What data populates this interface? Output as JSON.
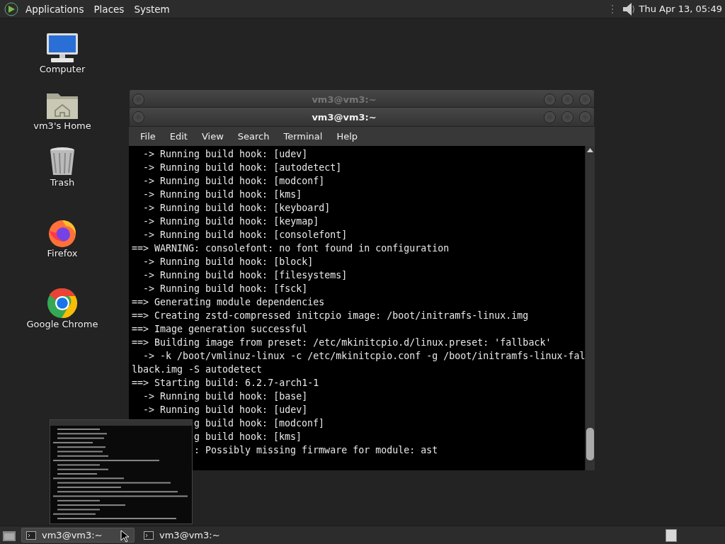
{
  "top_panel": {
    "menus": [
      "Applications",
      "Places",
      "System"
    ],
    "clock": "Thu Apr 13, 05:49"
  },
  "desktop_icons": [
    {
      "kind": "computer",
      "label": "Computer"
    },
    {
      "kind": "home",
      "label": "vm3's Home"
    },
    {
      "kind": "trash",
      "label": "Trash"
    },
    {
      "kind": "firefox",
      "label": "Firefox"
    },
    {
      "kind": "chrome",
      "label": "Google Chrome"
    }
  ],
  "windows": [
    {
      "title": "vm3@vm3:~",
      "active": false
    },
    {
      "title": "vm3@vm3:~",
      "active": true,
      "menu": [
        "File",
        "Edit",
        "View",
        "Search",
        "Terminal",
        "Help"
      ],
      "lines": [
        "  -> Running build hook: [udev]",
        "  -> Running build hook: [autodetect]",
        "  -> Running build hook: [modconf]",
        "  -> Running build hook: [kms]",
        "  -> Running build hook: [keyboard]",
        "  -> Running build hook: [keymap]",
        "  -> Running build hook: [consolefont]",
        "==> WARNING: consolefont: no font found in configuration",
        "  -> Running build hook: [block]",
        "  -> Running build hook: [filesystems]",
        "  -> Running build hook: [fsck]",
        "==> Generating module dependencies",
        "==> Creating zstd-compressed initcpio image: /boot/initramfs-linux.img",
        "==> Image generation successful",
        "==> Building image from preset: /etc/mkinitcpio.d/linux.preset: 'fallback'",
        "  -> -k /boot/vmlinuz-linux -c /etc/mkinitcpio.conf -g /boot/initramfs-linux-fal",
        "lback.img -S autodetect",
        "==> Starting build: 6.2.7-arch1-1",
        "  -> Running build hook: [base]",
        "  -> Running build hook: [udev]"
      ],
      "lines_behind_preview": [
        "g build hook: [modconf]",
        "g build hook: [kms]",
        ": Possibly missing firmware for module: ast"
      ]
    }
  ],
  "taskbar": {
    "tasks": [
      {
        "label": "vm3@vm3:~",
        "selected": true
      },
      {
        "label": "vm3@vm3:~",
        "selected": false
      }
    ]
  }
}
